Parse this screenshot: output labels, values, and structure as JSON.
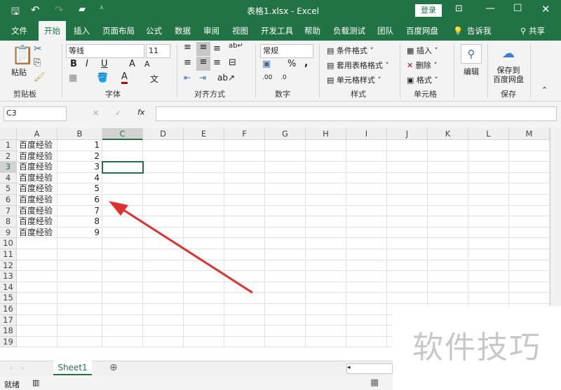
{
  "window": {
    "title": "表格1.xlsx  -  Excel",
    "login": "登录"
  },
  "tabs": [
    "文件",
    "开始",
    "插入",
    "页面布局",
    "公式",
    "数据",
    "审阅",
    "视图",
    "开发工具",
    "帮助",
    "负载测试",
    "团队",
    "百度网盘",
    "告诉我",
    "共享"
  ],
  "active_tab": "开始",
  "ribbon": {
    "clipboard": {
      "paste": "粘贴",
      "label": "剪贴板"
    },
    "font": {
      "name": "等线",
      "size": "11",
      "bold": "B",
      "italic": "I",
      "underline": "U",
      "grow": "A",
      "shrink": "A",
      "color": "A",
      "label": "字体",
      "font_color": "#c00000"
    },
    "alignment": {
      "label": "对齐方式"
    },
    "number": {
      "format": "常规",
      "percent": "%",
      "comma": ",",
      "label": "数字"
    },
    "styles": {
      "conditional": "条件格式",
      "table": "套用表格格式",
      "cell": "单元格样式",
      "label": "样式"
    },
    "cells": {
      "insert": "插入",
      "delete": "删除",
      "format": "格式",
      "label": "单元格"
    },
    "editing": {
      "label": "编辑"
    },
    "save": {
      "button": "保存到\n百度网盘",
      "label": "保存"
    }
  },
  "formula_bar": {
    "name_box": "C3",
    "fx": "fx",
    "cancel": "✕",
    "enter": "✓",
    "value": ""
  },
  "columns": [
    "A",
    "B",
    "C",
    "D",
    "E",
    "F",
    "G",
    "H",
    "I",
    "J",
    "K",
    "L",
    "M"
  ],
  "rows": [
    "1",
    "2",
    "3",
    "4",
    "5",
    "6",
    "7",
    "8",
    "9",
    "10",
    "11",
    "12",
    "13",
    "14",
    "15",
    "16",
    "17",
    "18",
    "19"
  ],
  "data": [
    [
      "百度经验",
      "1"
    ],
    [
      "百度经验",
      "2"
    ],
    [
      "百度经验",
      "3"
    ],
    [
      "百度经验",
      "4"
    ],
    [
      "百度经验",
      "5"
    ],
    [
      "百度经验",
      "6"
    ],
    [
      "百度经验",
      "7"
    ],
    [
      "百度经验",
      "8"
    ],
    [
      "百度经验",
      "9"
    ]
  ],
  "selected_cell": "C3",
  "sheets": [
    "Sheet1"
  ],
  "status": {
    "ready": "就绪"
  },
  "watermark": "软件技巧",
  "accent": "#217346",
  "arrow_color": "#e03030"
}
